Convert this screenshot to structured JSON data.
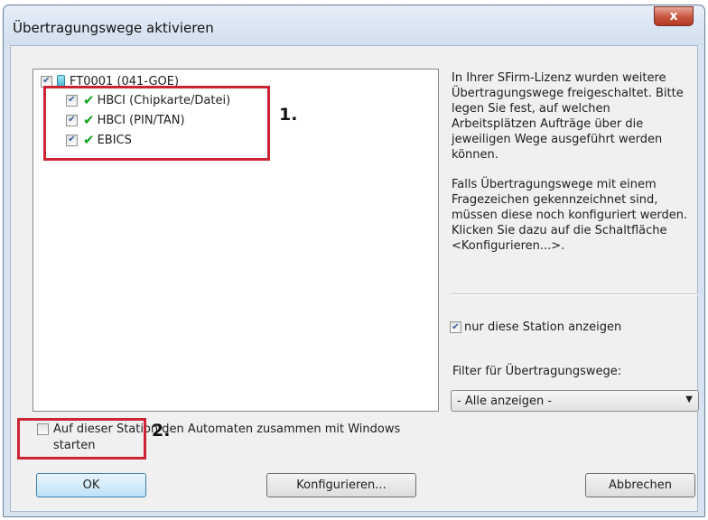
{
  "window": {
    "title": "Übertragungswege aktivieren",
    "close_label": "x"
  },
  "tree": {
    "root": {
      "label": "FT0001 (041-GOE)",
      "checked": true,
      "icon": "station-icon"
    },
    "children": [
      {
        "label": "HBCI (Chipkarte/Datei)",
        "checked": true,
        "status_icon": "green-check-icon"
      },
      {
        "label": "HBCI (PIN/TAN)",
        "checked": true,
        "status_icon": "green-check-icon"
      },
      {
        "label": "EBICS",
        "checked": true,
        "status_icon": "green-check-icon"
      }
    ]
  },
  "annotations": {
    "step1": "1.",
    "step2": "2.",
    "highlight_color": "#cc2433"
  },
  "info": {
    "paragraph1": "In Ihrer SFirm-Lizenz wurden weitere Übertragungswege freigeschaltet. Bitte legen Sie fest, auf welchen Arbeitsplätzen Aufträge über die jeweiligen Wege ausgeführt werden können.",
    "paragraph2": "Falls Übertragungswege mit einem Fragezeichen gekennzeichnet sind, müssen diese noch konfiguriert werden. Klicken Sie dazu auf die Schaltfläche <Konfigurieren...>."
  },
  "filters": {
    "station_only_label": "nur diese Station anzeigen",
    "station_only_checked": true,
    "filter_label": "Filter für Übertragungswege:",
    "dropdown_value": "- Alle anzeigen -"
  },
  "autostart": {
    "label": "Auf dieser Station den Automaten zusammen mit Windows starten",
    "checked": false
  },
  "buttons": {
    "ok": "OK",
    "configure": "Konfigurieren...",
    "cancel": "Abbrechen"
  }
}
